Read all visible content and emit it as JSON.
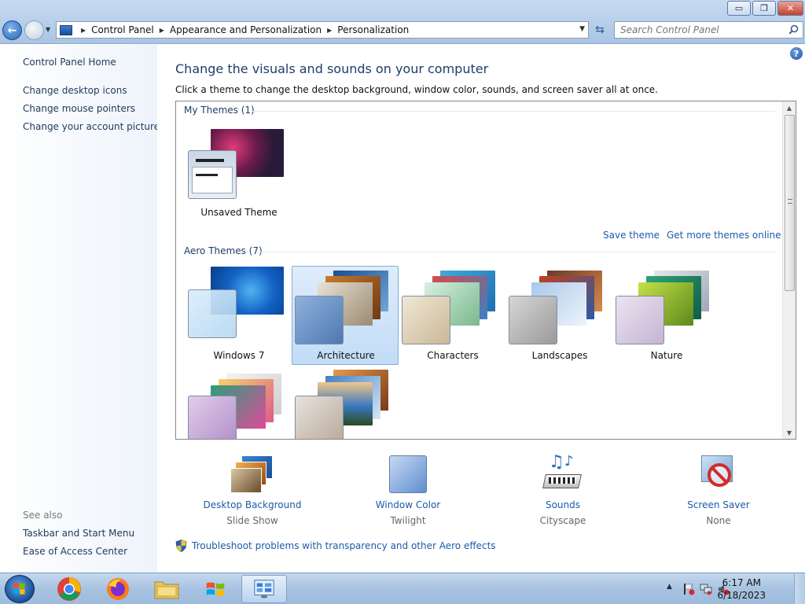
{
  "window": {
    "minimize_glyph": "▭",
    "maximize_glyph": "❐",
    "close_glyph": "✕"
  },
  "address_bar": {
    "crumbs": [
      "Control Panel",
      "Appearance and Personalization",
      "Personalization"
    ]
  },
  "search": {
    "placeholder": "Search Control Panel"
  },
  "sidebar": {
    "home": "Control Panel Home",
    "links": [
      "Change desktop icons",
      "Change mouse pointers",
      "Change your account picture"
    ],
    "see_also_header": "See also",
    "see_also": [
      "Taskbar and Start Menu",
      "Ease of Access Center"
    ]
  },
  "main": {
    "title": "Change the visuals and sounds on your computer",
    "subtitle": "Click a theme to change the desktop background, window color, sounds, and screen saver all at once.",
    "my_themes_header": "My Themes (1)",
    "my_themes": [
      {
        "name": "Unsaved Theme"
      }
    ],
    "save_theme": "Save theme",
    "get_more": "Get more themes online",
    "aero_header": "Aero Themes (7)",
    "aero_themes": [
      {
        "name": "Windows 7"
      },
      {
        "name": "Architecture",
        "selected": true
      },
      {
        "name": "Characters"
      },
      {
        "name": "Landscapes"
      },
      {
        "name": "Nature"
      },
      {
        "name": ""
      },
      {
        "name": ""
      }
    ]
  },
  "tools": [
    {
      "label": "Desktop Background",
      "value": "Slide Show",
      "icon": "desktop-background-icon"
    },
    {
      "label": "Window Color",
      "value": "Twilight",
      "icon": "window-color-icon"
    },
    {
      "label": "Sounds",
      "value": "Cityscape",
      "icon": "sounds-icon"
    },
    {
      "label": "Screen Saver",
      "value": "None",
      "icon": "screen-saver-icon"
    }
  ],
  "troubleshoot": "Troubleshoot problems with transparency and other Aero effects",
  "taskbar": {
    "time": "6:17 AM",
    "date": "6/18/2023",
    "tray_arrow": "▲"
  },
  "help_glyph": "?",
  "colors": {
    "accent": "#1e5aa8",
    "selected_bg": "#c2dcf7",
    "heading": "#1e3d6b"
  }
}
